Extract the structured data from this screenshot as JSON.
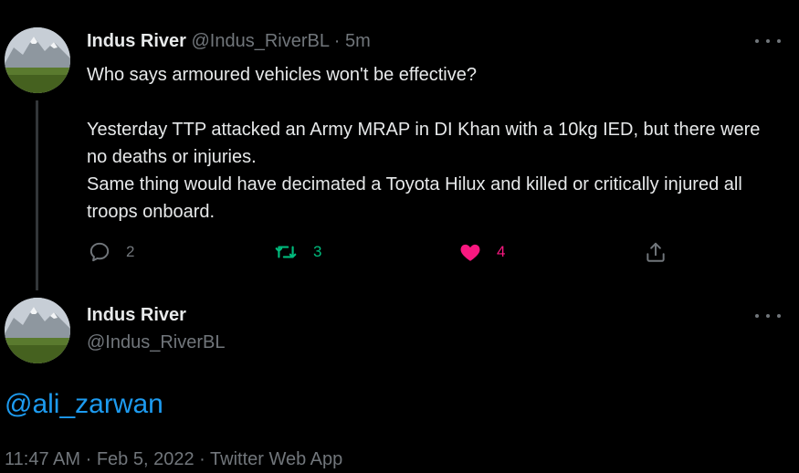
{
  "tweet1": {
    "display_name": "Indus River",
    "handle": "@Indus_RiverBL",
    "separator": "·",
    "time": "5m",
    "more_icon": "more-horizontal-icon",
    "body": {
      "line1": "Who says armoured vehicles won't be effective?",
      "line2": "Yesterday TTP attacked an Army MRAP in DI Khan with a 10kg IED, but there were no deaths or injuries.",
      "line3": "Same thing would have decimated a Toyota Hilux and killed or critically injured all troops onboard."
    },
    "actions": {
      "reply_count": "2",
      "retweet_count": "3",
      "like_count": "4",
      "reply_icon": "reply-icon",
      "retweet_icon": "retweet-icon",
      "like_icon": "heart-icon",
      "share_icon": "share-icon",
      "retweet_color": "#00ba7c",
      "like_color": "#f91880"
    }
  },
  "tweet2": {
    "display_name": "Indus River",
    "handle": "@Indus_RiverBL",
    "more_icon": "more-horizontal-icon",
    "body": "@ali_zarwan",
    "meta": {
      "time": "11:47 AM",
      "date": "Feb 5, 2022",
      "source": "Twitter Web App",
      "separator": "·"
    },
    "link_color": "#1d9bf0"
  }
}
